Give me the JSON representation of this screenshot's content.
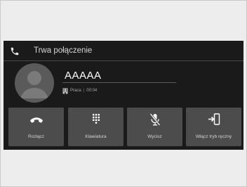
{
  "header": {
    "title": "Trwa połączenie",
    "icon": "phone-icon"
  },
  "caller": {
    "name": "AAAAA",
    "number_type": "Praca",
    "duration": "00:04",
    "number_type_icon": "building-icon"
  },
  "buttons": [
    {
      "label": "Rozłącz",
      "icon": "hang-up-icon"
    },
    {
      "label": "Klawiatura",
      "icon": "keypad-icon"
    },
    {
      "label": "Wycisz",
      "icon": "microphone-muted-icon"
    },
    {
      "label": "Włącz tryb ręczny",
      "icon": "handset-transfer-icon"
    }
  ],
  "colors": {
    "screen_bg": "#1a1a1a",
    "button_bg": "#4c4c4c",
    "text_primary": "#ffffff",
    "text_secondary": "#a8a8a8"
  }
}
